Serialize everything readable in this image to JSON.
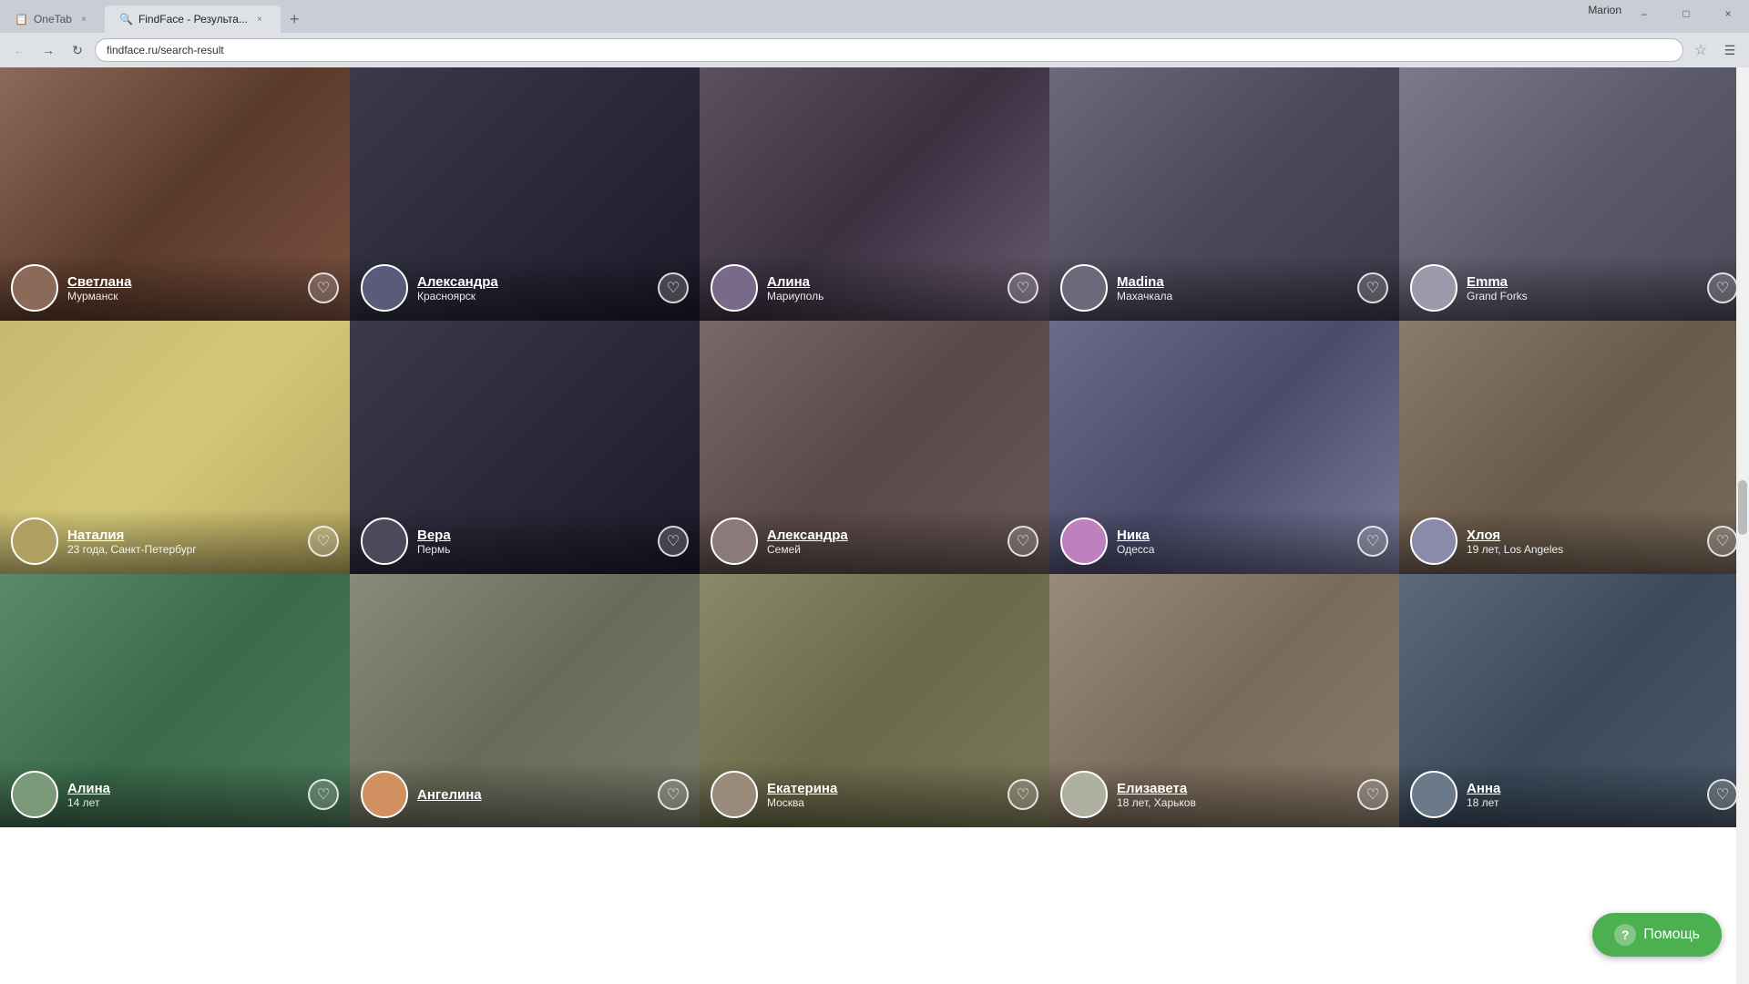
{
  "browser": {
    "tabs": [
      {
        "id": "onetab",
        "label": "OneTab",
        "active": false,
        "favicon": "📋"
      },
      {
        "id": "findface",
        "label": "FindFace - Результа...",
        "active": true,
        "favicon": "🔍"
      }
    ],
    "address": "findface.ru/search-result",
    "user": "Marion",
    "window_controls": {
      "minimize": "–",
      "maximize": "□",
      "close": "×"
    }
  },
  "grid": {
    "rows": [
      {
        "cards": [
          {
            "id": 1,
            "name": "Светлана",
            "location": "Мурманск",
            "img_class": "img-1"
          },
          {
            "id": 2,
            "name": "Александра",
            "location": "Красноярск",
            "img_class": "img-2"
          },
          {
            "id": 3,
            "name": "Алина",
            "location": "Мариуполь",
            "img_class": "img-3"
          },
          {
            "id": 4,
            "name": "Madina",
            "location": "Махачкала",
            "img_class": "img-4"
          },
          {
            "id": 5,
            "name": "Emma",
            "location": "Grand Forks",
            "img_class": "img-5"
          }
        ]
      },
      {
        "cards": [
          {
            "id": 6,
            "name": "Наталия",
            "location": "23 года, Санкт-Петербург",
            "img_class": "img-6"
          },
          {
            "id": 7,
            "name": "Вера",
            "location": "Пермь",
            "img_class": "img-7"
          },
          {
            "id": 8,
            "name": "Александра",
            "location": "Семей",
            "img_class": "img-8"
          },
          {
            "id": 9,
            "name": "Ника",
            "location": "Одесса",
            "img_class": "img-9"
          },
          {
            "id": 10,
            "name": "Хлоя",
            "location": "19 лет, Los Angeles",
            "img_class": "img-10"
          }
        ]
      },
      {
        "cards": [
          {
            "id": 11,
            "name": "Алина",
            "location": "14 лет",
            "img_class": "img-11"
          },
          {
            "id": 12,
            "name": "Ангелина",
            "location": "",
            "img_class": "img-12"
          },
          {
            "id": 13,
            "name": "Екатерина",
            "location": "Москва",
            "img_class": "img-13"
          },
          {
            "id": 14,
            "name": "Елизавета",
            "location": "18 лет, Харьков",
            "img_class": "img-14"
          },
          {
            "id": 15,
            "name": "Анна",
            "location": "18 лет",
            "img_class": "img-15"
          }
        ]
      }
    ]
  },
  "help_button": {
    "label": "Помощь",
    "icon": "?"
  }
}
